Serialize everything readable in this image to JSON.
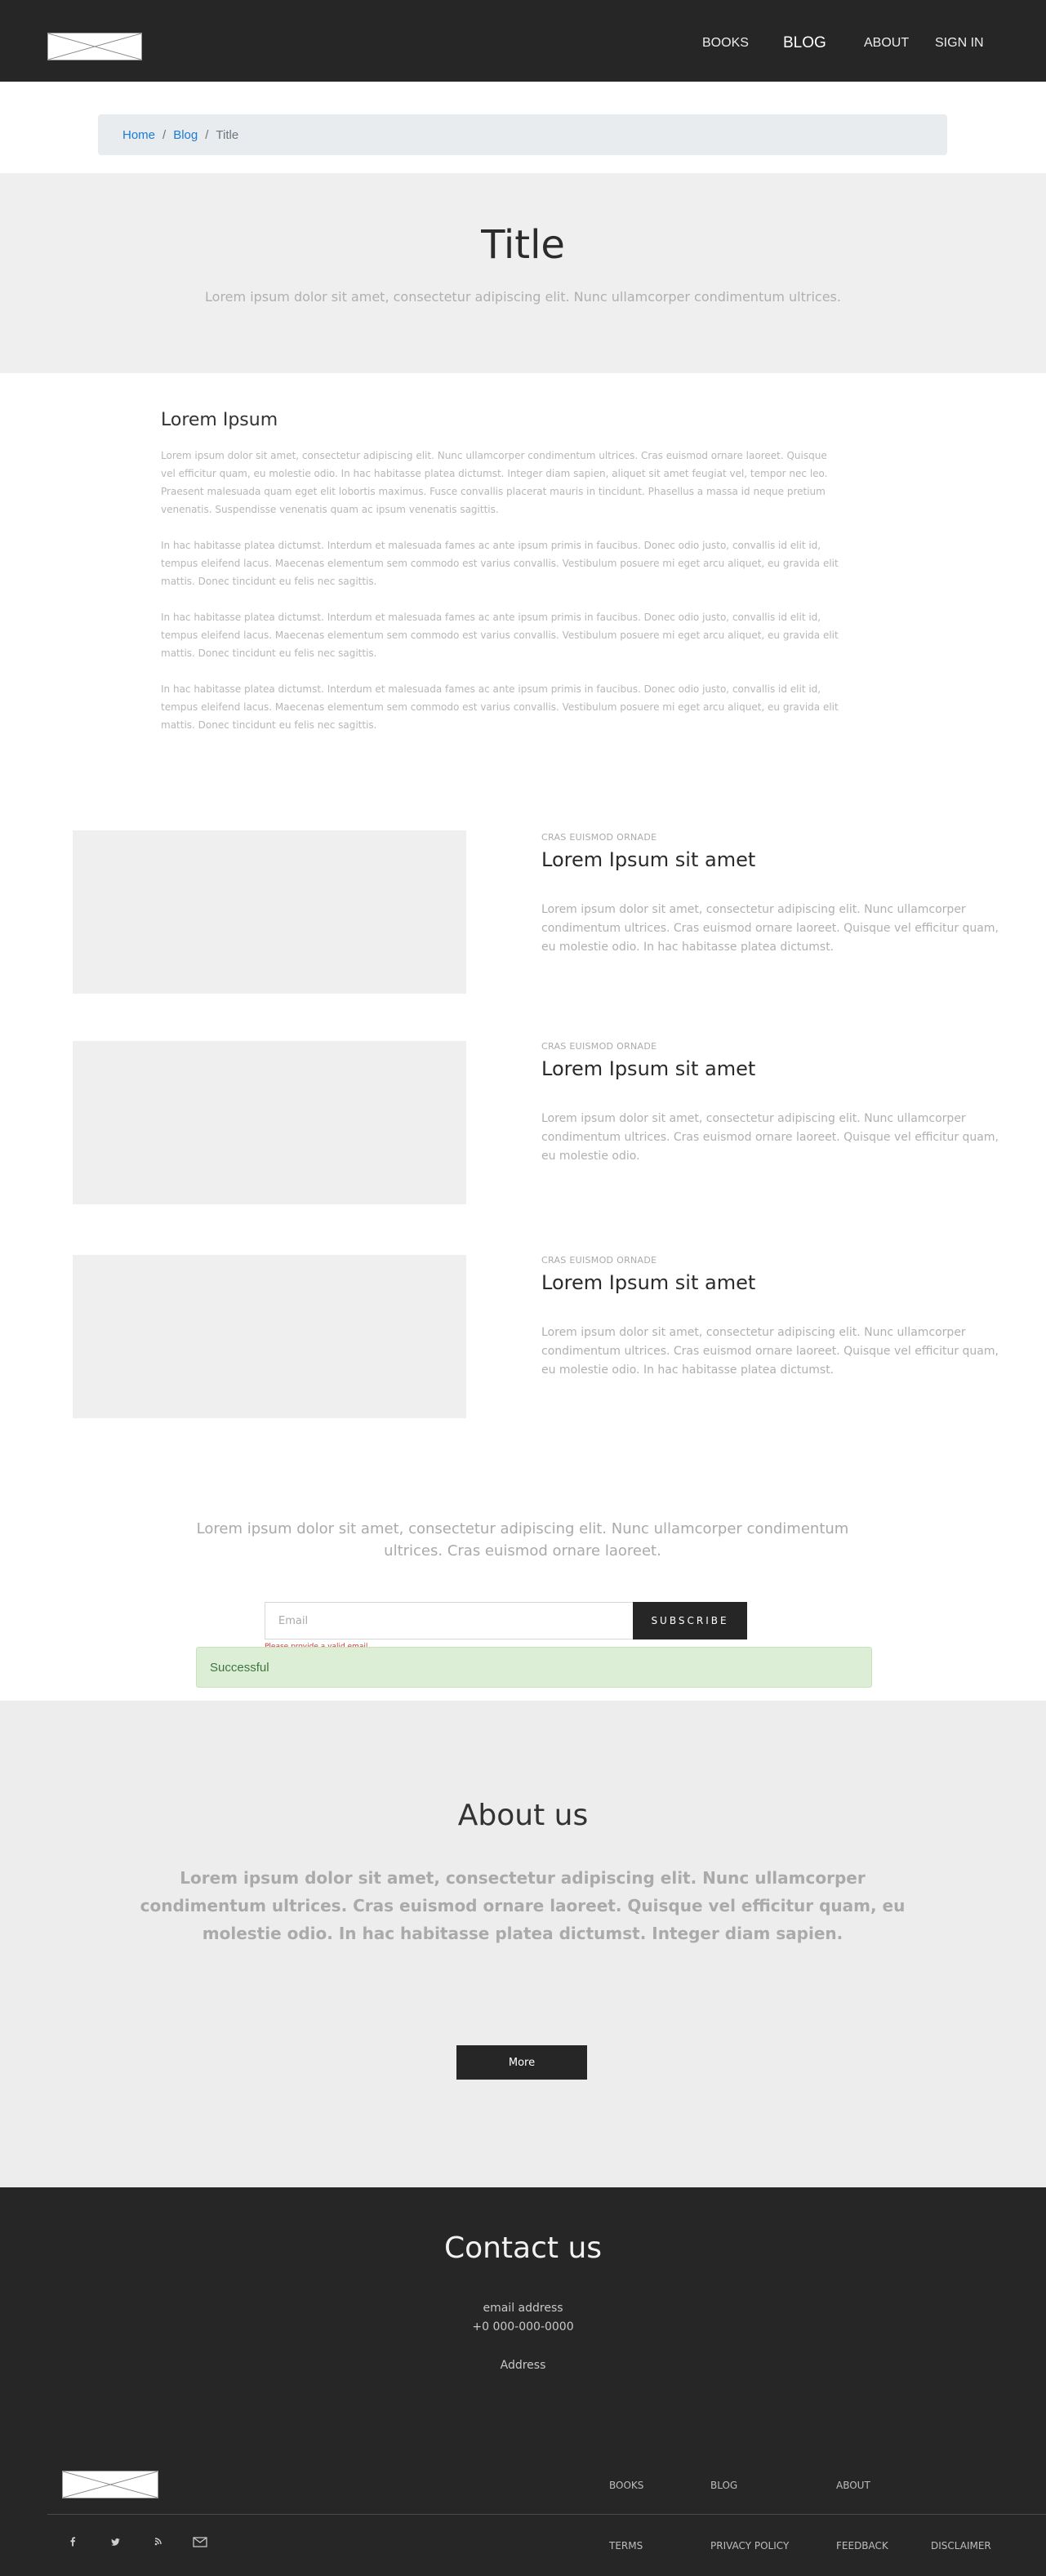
{
  "nav": {
    "logo_alt": "logo placeholder",
    "links": [
      "BOOKS",
      "BLOG",
      "ABOUT",
      "SIGN IN"
    ]
  },
  "breadcrumb": {
    "items": [
      "Home",
      "Blog"
    ],
    "current": "Title",
    "separator": "/"
  },
  "hero": {
    "title": "Title",
    "subtitle": "Lorem ipsum dolor sit amet, consectetur adipiscing elit. Nunc ullamcorper condimentum ultrices."
  },
  "article": {
    "heading": "Lorem Ipsum",
    "paragraphs": [
      "Lorem ipsum dolor sit amet, consectetur adipiscing elit. Nunc ullamcorper condimentum ultrices. Cras euismod ornare laoreet. Quisque vel efficitur quam, eu molestie odio. In hac habitasse platea dictumst. Integer diam sapien, aliquet sit amet feugiat vel, tempor nec leo. Praesent malesuada quam eget elit lobortis maximus. Fusce convallis placerat mauris in tincidunt. Phasellus a massa id neque pretium venenatis. Suspendisse venenatis quam ac ipsum venenatis sagittis.",
      "In hac habitasse platea dictumst. Interdum et malesuada fames ac ante ipsum primis in faucibus. Donec odio justo, convallis id elit id, tempus eleifend lacus. Maecenas elementum sem commodo est varius convallis. Vestibulum posuere mi eget arcu aliquet, eu gravida elit mattis. Donec tincidunt eu felis nec sagittis.",
      "In hac habitasse platea dictumst. Interdum et malesuada fames ac ante ipsum primis in faucibus. Donec odio justo, convallis id elit id, tempus eleifend lacus. Maecenas elementum sem commodo est varius convallis. Vestibulum posuere mi eget arcu aliquet, eu gravida elit mattis. Donec tincidunt eu felis nec sagittis.",
      "In hac habitasse platea dictumst. Interdum et malesuada fames ac ante ipsum primis in faucibus. Donec odio justo, convallis id elit id, tempus eleifend lacus. Maecenas elementum sem commodo est varius convallis. Vestibulum posuere mi eget arcu aliquet, eu gravida elit mattis. Donec tincidunt eu felis nec sagittis."
    ]
  },
  "posts": [
    {
      "kicker": "CRAS EUISMOD ORNADE",
      "title": "Lorem Ipsum sit amet",
      "description": "Lorem ipsum dolor sit amet, consectetur adipiscing elit. Nunc ullamcorper condimentum ultrices. Cras euismod ornare laoreet. Quisque vel efficitur quam, eu molestie odio. In hac habitasse platea dictumst."
    },
    {
      "kicker": "CRAS EUISMOD ORNADE",
      "title": "Lorem Ipsum sit amet",
      "description": "Lorem ipsum dolor sit amet, consectetur adipiscing elit. Nunc ullamcorper condimentum ultrices. Cras euismod ornare laoreet. Quisque vel efficitur quam, eu molestie odio."
    },
    {
      "kicker": "CRAS EUISMOD ORNADE",
      "title": "Lorem Ipsum sit amet",
      "description": "Lorem ipsum dolor sit amet, consectetur adipiscing elit. Nunc ullamcorper condimentum ultrices. Cras euismod ornare laoreet. Quisque vel efficitur quam, eu molestie odio. In hac habitasse platea dictumst."
    }
  ],
  "newsletter": {
    "text": "Lorem ipsum dolor sit amet, consectetur adipiscing elit. Nunc ullamcorper condimentum ultrices. Cras euismod ornare laoreet.",
    "email_placeholder": "Email",
    "email_value": "",
    "subscribe_label": "SUBSCRIBE",
    "error": "Please provide a valid email",
    "success": "Successful"
  },
  "about": {
    "title": "About us",
    "text": "Lorem ipsum dolor sit amet, consectetur adipiscing elit. Nunc ullamcorper condimentum ultrices. Cras euismod ornare laoreet. Quisque vel efficitur quam, eu molestie odio. In hac habitasse platea dictumst. Integer diam sapien.",
    "button": "More"
  },
  "contact": {
    "title": "Contact us",
    "email": "email address",
    "phone": "+0 000-000-0000",
    "address": "Address"
  },
  "footer": {
    "nav": [
      "BOOKS",
      "BLOG",
      "ABOUT"
    ],
    "legal": [
      "TERMS",
      "PRIVACY POLICY",
      "FEEDBACK",
      "DISCLAIMER"
    ],
    "social_icons": [
      "facebook-icon",
      "twitter-icon",
      "rss-icon",
      "mail-icon"
    ]
  },
  "colors": {
    "dark": "#262626",
    "link_blue": "#1a7ad4",
    "light_panel": "#efefef",
    "success_bg": "#ddeed6",
    "error": "#d23a3a"
  }
}
